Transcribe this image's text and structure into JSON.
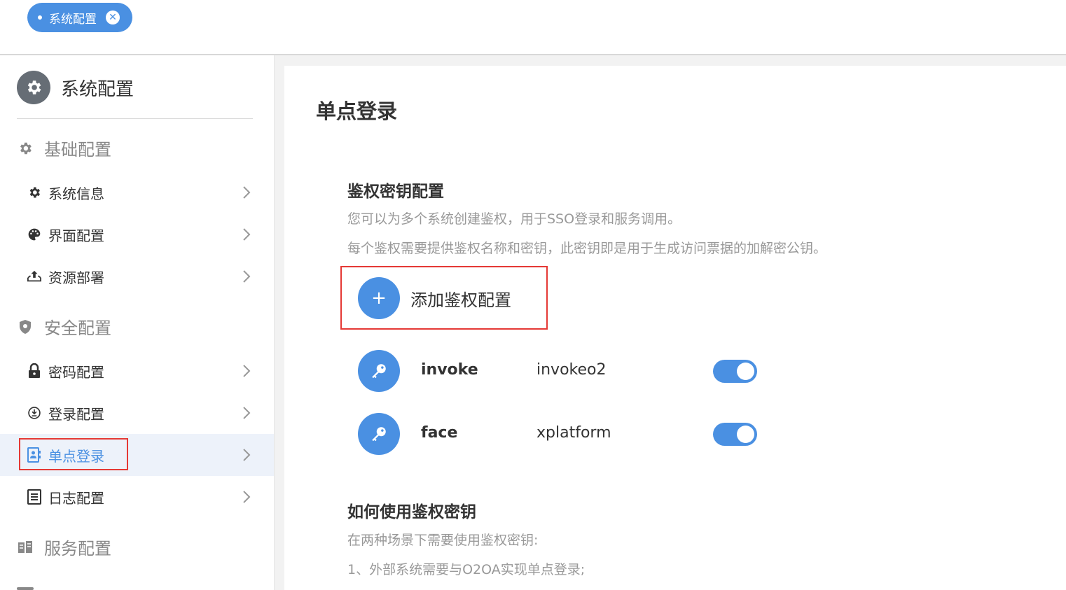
{
  "tabs": [
    {
      "label": "系统配置",
      "closable": true
    }
  ],
  "sidebar": {
    "title": "系统配置",
    "groups": [
      {
        "label": "基础配置",
        "icon": "gear-icon",
        "items": [
          {
            "label": "系统信息",
            "icon": "gear-icon"
          },
          {
            "label": "界面配置",
            "icon": "palette-icon"
          },
          {
            "label": "资源部署",
            "icon": "upload-tray-icon"
          }
        ]
      },
      {
        "label": "安全配置",
        "icon": "shield-icon",
        "items": [
          {
            "label": "密码配置",
            "icon": "lock-icon"
          },
          {
            "label": "登录配置",
            "icon": "clock-arrow-icon"
          },
          {
            "label": "单点登录",
            "icon": "contact-card-icon",
            "active": true
          },
          {
            "label": "日志配置",
            "icon": "list-doc-icon"
          }
        ]
      },
      {
        "label": "服务配置",
        "icon": "server-icon",
        "items": []
      }
    ]
  },
  "main": {
    "title": "单点登录",
    "auth_section": {
      "title": "鉴权密钥配置",
      "desc1": "您可以为多个系统创建鉴权，用于SSO登录和服务调用。",
      "desc2": "每个鉴权需要提供鉴权名称和密钥，此密钥即是用于生成访问票据的加解密公钥。",
      "add_label": "添加鉴权配置",
      "keys": [
        {
          "name": "invoke",
          "value": "invokeo2",
          "enabled": true
        },
        {
          "name": "face",
          "value": "xplatform",
          "enabled": true
        }
      ]
    },
    "usage_section": {
      "title": "如何使用鉴权密钥",
      "desc1": "在两种场景下需要使用鉴权密钥:",
      "desc2": "1、外部系统需要与O2OA实现单点登录;"
    }
  },
  "colors": {
    "accent": "#4a90e2",
    "highlight_border": "#e53935",
    "active_bg": "#edf2fa"
  }
}
